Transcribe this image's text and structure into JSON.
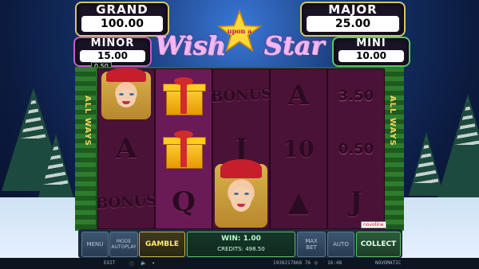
{
  "jackpots": {
    "grand": {
      "label": "GRAND",
      "value": "100.00"
    },
    "major": {
      "label": "MAJOR",
      "value": "25.00"
    },
    "minor": {
      "label": "MINOR",
      "value": "15.00"
    },
    "mini": {
      "label": "MINI",
      "value": "10.00"
    }
  },
  "bet_badge": "0.50",
  "logo": {
    "word1": "Wish",
    "word2": "Star",
    "upon": "upon a"
  },
  "frame_side_text": "ALL WAYS",
  "reels": [
    {
      "cells": [
        {
          "type": "girl"
        },
        {
          "type": "letter",
          "text": "A"
        },
        {
          "type": "bonus",
          "text": "BONUS"
        }
      ]
    },
    {
      "cells": [
        {
          "type": "gift"
        },
        {
          "type": "gift"
        },
        {
          "type": "letter",
          "text": "Q"
        }
      ]
    },
    {
      "cells": [
        {
          "type": "bonus",
          "text": "BONUS"
        },
        {
          "type": "letter",
          "text": "J"
        },
        {
          "type": "girl"
        }
      ]
    },
    {
      "cells": [
        {
          "type": "letter",
          "text": "A"
        },
        {
          "type": "letter",
          "text": "10"
        },
        {
          "type": "tree",
          "text": "▲"
        }
      ]
    },
    {
      "cells": [
        {
          "type": "value",
          "text": "3.50"
        },
        {
          "type": "value",
          "text": "0.50"
        },
        {
          "type": "letter",
          "text": "J"
        }
      ]
    }
  ],
  "novoline_badge": "novoline",
  "controls": {
    "menu": "MENU",
    "mode": {
      "top": "MODE",
      "bottom": "AUTOPLAY"
    },
    "gamble": "GAMBLE",
    "win_label": "WIN: 1.00",
    "credits_label": "CREDITS: 498.50",
    "max_bet": {
      "top": "MAX",
      "bottom": "BET"
    },
    "auto": {
      "top": "AUTO",
      "bottom": ""
    },
    "collect": "COLLECT"
  },
  "status_bar": {
    "exit": "EXIT",
    "session_id": "1938217868 76",
    "time": "16:48",
    "brand": "NOVOMATIC"
  }
}
